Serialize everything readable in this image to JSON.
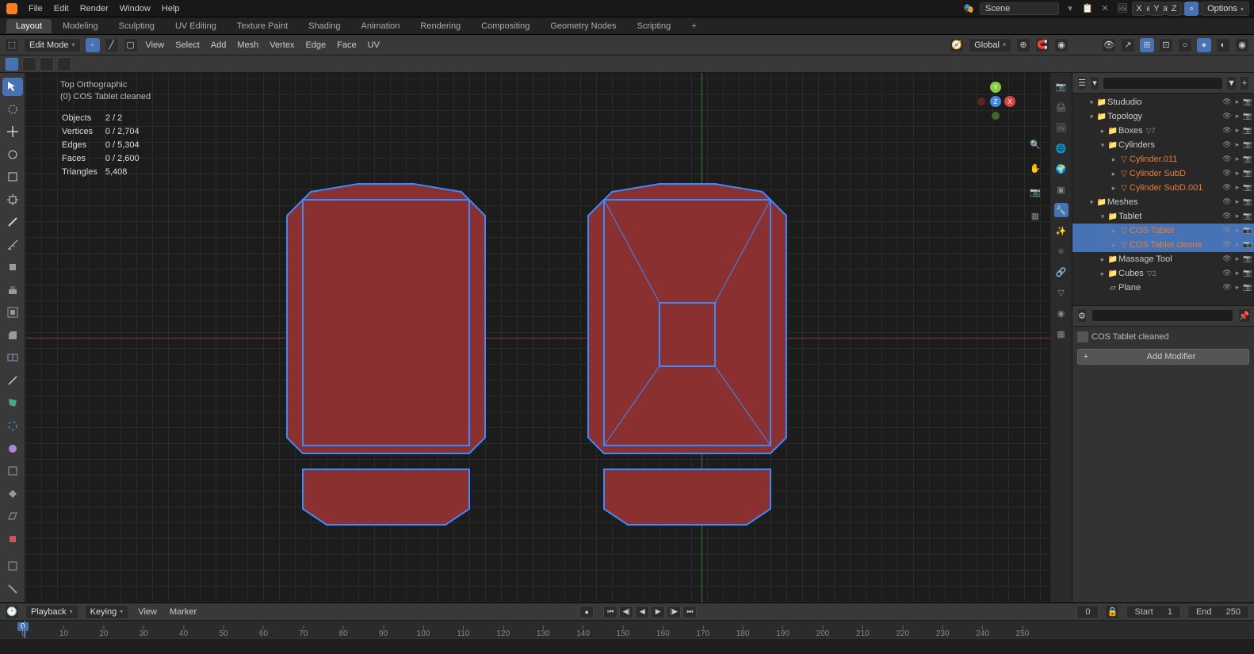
{
  "menubar": [
    "File",
    "Edit",
    "Render",
    "Window",
    "Help"
  ],
  "workspaces": [
    "Layout",
    "Modeling",
    "Sculpting",
    "UV Editing",
    "Texture Paint",
    "Shading",
    "Animation",
    "Rendering",
    "Compositing",
    "Geometry Nodes",
    "Scripting"
  ],
  "active_workspace": "Layout",
  "scene": {
    "scene_label": "Scene",
    "layer_label": "ViewLayer"
  },
  "header2": {
    "mode": "Edit Mode",
    "view": "View",
    "select": "Select",
    "add": "Add",
    "mesh": "Mesh",
    "vertex": "Vertex",
    "edge": "Edge",
    "face": "Face",
    "uv": "UV",
    "orientation": "Global",
    "options": "Options"
  },
  "overlay": {
    "viewname": "Top Orthographic",
    "objname": "(0) COS Tablet cleaned",
    "stats": [
      [
        "Objects",
        "2 / 2"
      ],
      [
        "Vertices",
        "0 / 2,704"
      ],
      [
        "Edges",
        "0 / 5,304"
      ],
      [
        "Faces",
        "0 / 2,600"
      ],
      [
        "Triangles",
        "5,408"
      ]
    ]
  },
  "outliner": {
    "items": [
      {
        "lvl": 1,
        "tw": "▾",
        "ico": "📁",
        "lbl": "Stududio",
        "sel": false
      },
      {
        "lvl": 1,
        "tw": "▾",
        "ico": "📁",
        "lbl": "Topology",
        "sel": false
      },
      {
        "lvl": 2,
        "tw": "▸",
        "ico": "📁",
        "lbl": "Boxes",
        "badge": "▽7",
        "sel": false
      },
      {
        "lvl": 2,
        "tw": "▾",
        "ico": "📁",
        "lbl": "Cylinders",
        "sel": false
      },
      {
        "lvl": 3,
        "tw": "▸",
        "ico": "▽",
        "lbl": "Cylinder.011",
        "sel": false,
        "orange": true
      },
      {
        "lvl": 3,
        "tw": "▸",
        "ico": "▽",
        "lbl": "Cylinder SubD",
        "sel": false,
        "orange": true
      },
      {
        "lvl": 3,
        "tw": "▸",
        "ico": "▽",
        "lbl": "Cylinder SubD.001",
        "sel": false,
        "orange": true
      },
      {
        "lvl": 1,
        "tw": "▾",
        "ico": "📁",
        "lbl": "Meshes",
        "sel": false
      },
      {
        "lvl": 2,
        "tw": "▾",
        "ico": "📁",
        "lbl": "Tablet",
        "sel": false
      },
      {
        "lvl": 3,
        "tw": "▸",
        "ico": "▽",
        "lbl": "COS Tablet",
        "sel": true,
        "orange": true
      },
      {
        "lvl": 3,
        "tw": "▸",
        "ico": "▽",
        "lbl": "COS Tablet cleane",
        "sel": true,
        "orange": true
      },
      {
        "lvl": 2,
        "tw": "▸",
        "ico": "📁",
        "lbl": "Massage Tool",
        "sel": false
      },
      {
        "lvl": 2,
        "tw": "▸",
        "ico": "📁",
        "lbl": "Cubes",
        "badge": "▽2",
        "sel": false
      },
      {
        "lvl": 2,
        "tw": "",
        "ico": "▱",
        "lbl": "Plane",
        "sel": false
      }
    ]
  },
  "props": {
    "obj": "COS Tablet cleaned",
    "addmod": "Add Modifier"
  },
  "timeline": {
    "playback": "Playback",
    "keying": "Keying",
    "view": "View",
    "marker": "Marker",
    "current": 0,
    "start_label": "Start",
    "start": 1,
    "end_label": "End",
    "end": 250,
    "ticks": [
      0,
      10,
      20,
      30,
      40,
      50,
      60,
      70,
      80,
      90,
      100,
      110,
      120,
      130,
      140,
      150,
      160,
      170,
      180,
      190,
      200,
      210,
      220,
      230,
      240,
      250
    ]
  }
}
